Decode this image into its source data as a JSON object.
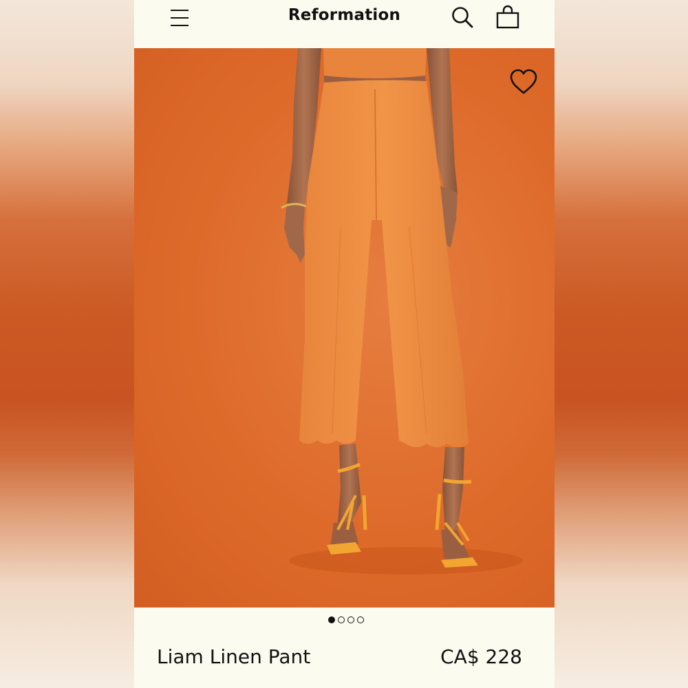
{
  "header": {
    "brand": "Reformation",
    "icons": {
      "menu": "hamburger-menu-icon",
      "search": "search-icon",
      "bag": "shopping-bag-icon"
    }
  },
  "product_image": {
    "favorite_icon": "heart-icon",
    "carousel": {
      "total_slides": 4,
      "active_slide": 1
    }
  },
  "product": {
    "name": "Liam Linen Pant",
    "price": "CA$ 228"
  },
  "colors": {
    "background": "#fcfbf0",
    "text": "#111111",
    "hero_orange": "#de6a2a",
    "pant_orange": "#ee8a3e",
    "sandal_yellow": "#f2a531"
  }
}
